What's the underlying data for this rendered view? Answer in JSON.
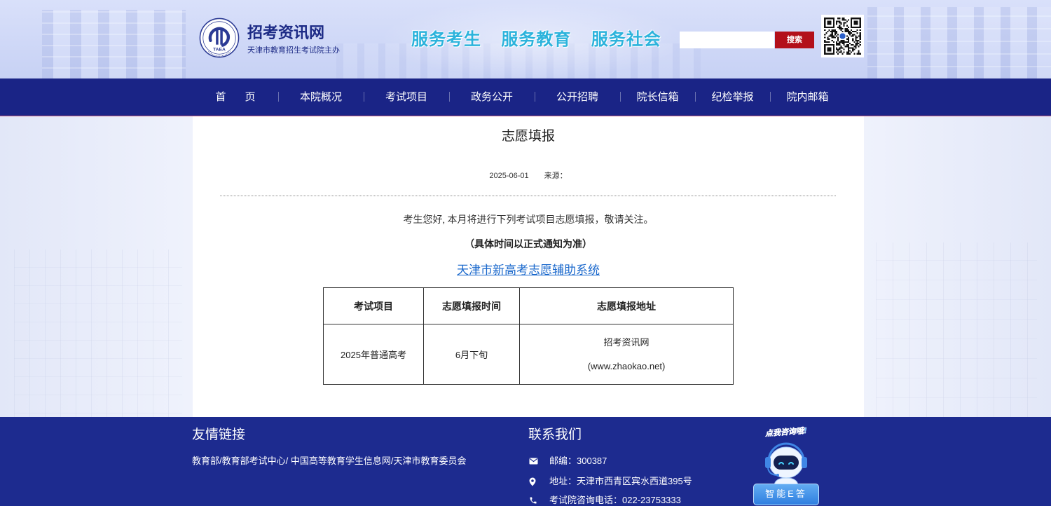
{
  "header": {
    "logo_text": "TAEA",
    "site_title": "招考资讯网",
    "site_subtitle": "天津市教育招生考试院主办",
    "slogan": [
      "服务考生",
      "服务教育",
      "服务社会"
    ],
    "search": {
      "value": "",
      "button_label": "搜索"
    },
    "icons": {
      "logo": "taea-logo-icon",
      "qr": "qr-code-icon"
    }
  },
  "nav": {
    "items": [
      "首　页",
      "本院概况",
      "考试项目",
      "政务公开",
      "公开招聘",
      "院长信箱",
      "纪检举报",
      "院内邮箱"
    ]
  },
  "article": {
    "title": "志愿填报",
    "date": "2025-06-01",
    "source_label": "来源：",
    "intro": "考生您好, 本月将进行下列考试项目志愿填报，敬请关注。",
    "note": "（具体时间以正式通知为准）",
    "link_text": "天津市新高考志愿辅助系统",
    "table": {
      "headers": [
        "考试项目",
        "志愿填报时间",
        "志愿填报地址"
      ],
      "rows": [
        {
          "exam": "2025年普通高考",
          "time": "6月下旬",
          "address_name": "招考资讯网",
          "address_url": "(www.zhaokao.net)"
        }
      ]
    }
  },
  "footer": {
    "links_heading": "友情链接",
    "links": [
      "教育部",
      "教育部考试中心",
      "中国高等教育学生信息网",
      "天津市教育委员会"
    ],
    "link_separators": [
      "/",
      "/ ",
      "/"
    ],
    "contact_heading": "联系我们",
    "contacts": [
      {
        "icon": "mail-icon",
        "text": "邮编：300387"
      },
      {
        "icon": "location-pin-icon",
        "text": "地址：天津市西青区宾水西道395号"
      },
      {
        "icon": "phone-icon",
        "text": "考试院咨询电话：022-23753333"
      }
    ],
    "assistant": {
      "icon": "robot-assistant-icon",
      "bubble_text": "点我咨询哦!",
      "button_label": "智能E答"
    }
  },
  "colors": {
    "nav_bg": "#1a2486",
    "footer_bg": "#1d2b8f",
    "accent_red": "#b3101a",
    "link_blue": "#1a68cc",
    "slogan_cyan": "#2cb3dc",
    "title_navy": "#1d2b86"
  }
}
